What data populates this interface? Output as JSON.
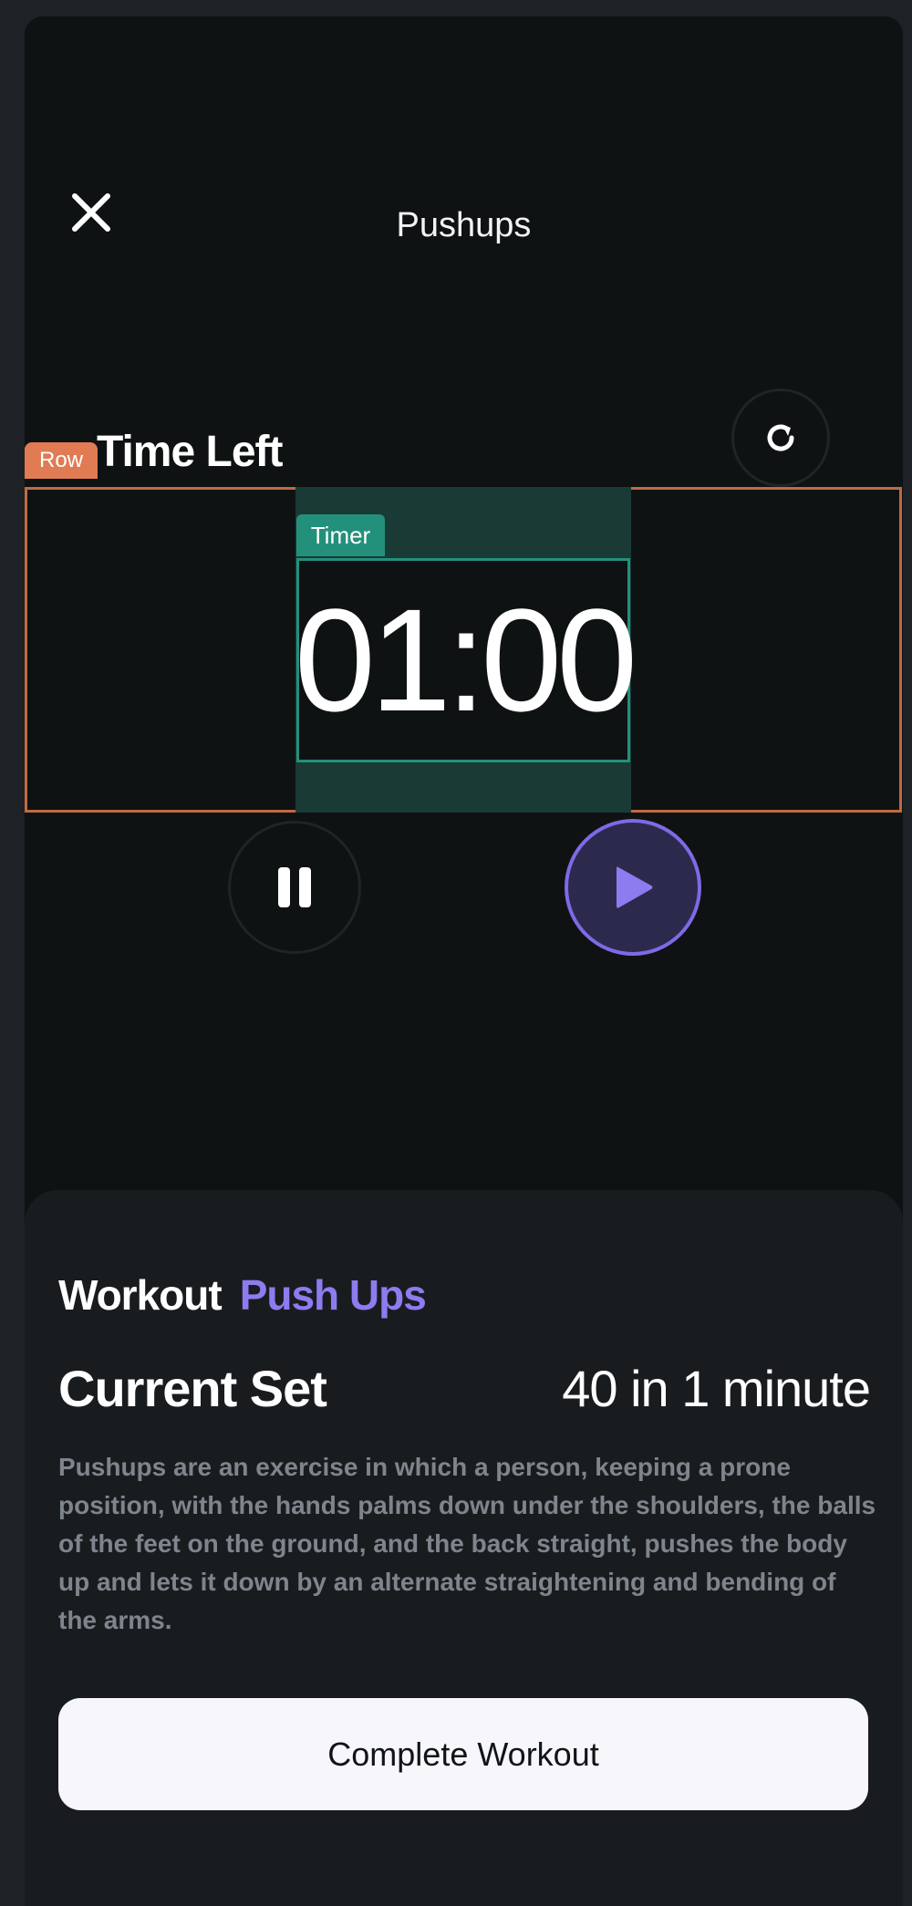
{
  "header": {
    "title": "Pushups",
    "close_icon": "close-icon"
  },
  "timer_section": {
    "label": "Time Left",
    "refresh_icon": "refresh-icon",
    "value": "01:00",
    "pause_icon": "pause-icon",
    "play_icon": "play-icon"
  },
  "debug_overlay": {
    "row_tag": "Row",
    "timer_tag": "Timer"
  },
  "workout": {
    "label": "Workout",
    "name": "Push Ups",
    "current_set_label": "Current Set",
    "current_set_value": "40 in 1 minute",
    "description": "Pushups are an exercise in which a person, keeping a prone position, with the hands palms down under the shoulders, the balls of the feet on the ground, and the back straight, pushes the body up and lets it down by an alternate straightening and bending of the arms.",
    "complete_button": "Complete Workout"
  },
  "colors": {
    "accent": "#8c7cf0",
    "background": "#0f1213",
    "sheet": "#191c1f",
    "row_overlay": "#e07b53",
    "timer_overlay": "#23907c"
  }
}
